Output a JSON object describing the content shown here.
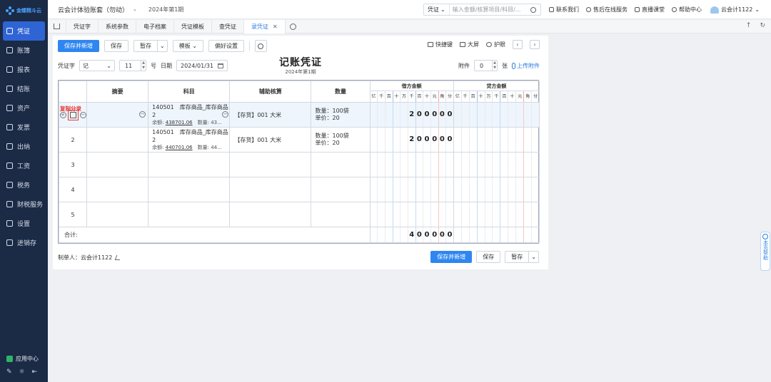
{
  "brand": {
    "logo_text": "金蝶精斗云"
  },
  "sidebar": {
    "items": [
      {
        "label": "凭证",
        "icon": "voucher-icon",
        "active": true
      },
      {
        "label": "账簿",
        "icon": "ledger-icon"
      },
      {
        "label": "报表",
        "icon": "report-icon"
      },
      {
        "label": "结账",
        "icon": "closing-icon"
      },
      {
        "label": "资产",
        "icon": "asset-icon"
      },
      {
        "label": "发票",
        "icon": "invoice-icon"
      },
      {
        "label": "出纳",
        "icon": "cashier-icon"
      },
      {
        "label": "工资",
        "icon": "salary-icon"
      },
      {
        "label": "税务",
        "icon": "tax-icon"
      },
      {
        "label": "财税服务",
        "icon": "service-icon"
      },
      {
        "label": "设置",
        "icon": "settings-icon"
      },
      {
        "label": "进销存",
        "icon": "inventory-icon"
      }
    ],
    "app_center": "应用中心"
  },
  "topbar": {
    "company": "云会计体验账套（勿动）",
    "period": "2024年第1期",
    "search_type": "凭证",
    "search_placeholder": "输入金额/核算项目/科目/...",
    "links": [
      "联系我们",
      "售后在线服务",
      "直播课堂",
      "帮助中心"
    ],
    "user": "云会计1122"
  },
  "tabs": [
    {
      "label": "凭证字"
    },
    {
      "label": "系统参数"
    },
    {
      "label": "电子档案"
    },
    {
      "label": "凭证模板"
    },
    {
      "label": "查凭证"
    },
    {
      "label": "录凭证",
      "active": true
    }
  ],
  "toolbar": {
    "save_new": "保存并新增",
    "save": "保存",
    "draft": "暂存",
    "template": "模板",
    "preference": "偏好设置",
    "shortcut": "快捷键",
    "fullscreen": "大屏",
    "eye_care": "护眼"
  },
  "voucher": {
    "title": "记账凭证",
    "subtitle": "2024年第1期",
    "word_label": "凭证字",
    "word_value": "记",
    "number_value": "11",
    "number_suffix": "号",
    "date_label": "日期",
    "date_value": "2024/01/31",
    "attach_label": "附件",
    "attach_value": "0",
    "attach_suffix": "张",
    "upload_label": "上传附件",
    "copy_label": "复制分录",
    "headers": {
      "summary": "摘要",
      "subject": "科目",
      "aux": "辅助核算",
      "qty": "数量",
      "debit": "借方金额",
      "credit": "贷方金额"
    },
    "digit_units": [
      "亿",
      "千",
      "百",
      "十",
      "万",
      "千",
      "百",
      "十",
      "元",
      "角",
      "分"
    ],
    "rows": [
      {
        "num": "1",
        "subject_line1": "140501　库存商品_库存商品2",
        "balance_label": "余额:",
        "balance": "438701.06",
        "qty_label": "数量: 43...",
        "aux": "【存货】001 大米",
        "qty": "数量：100袋",
        "price": "单价：20",
        "debit_digits": [
          "",
          "",
          "",
          "",
          "",
          "2",
          "0",
          "0",
          "0",
          "0",
          "0"
        ]
      },
      {
        "num": "2",
        "subject_line1": "140501　库存商品_库存商品2",
        "balance_label": "余额:",
        "balance": "440701.06",
        "qty_label": "数量: 44...",
        "aux": "【存货】001 大米",
        "qty": "数量：100袋",
        "price": "单价：20",
        "debit_digits": [
          "",
          "",
          "",
          "",
          "",
          "2",
          "0",
          "0",
          "0",
          "0",
          "0"
        ]
      },
      {
        "num": "3"
      },
      {
        "num": "4"
      },
      {
        "num": "5"
      }
    ],
    "total_label": "合计:",
    "total_debit_digits": [
      "",
      "",
      "",
      "",
      "",
      "4",
      "0",
      "0",
      "0",
      "0",
      "0"
    ]
  },
  "footer": {
    "maker_label": "制单人：",
    "maker": "云会计1122",
    "save_new": "保存并新增",
    "save": "保存",
    "draft": "暂存"
  },
  "help_float": {
    "label": "本页帮助"
  }
}
